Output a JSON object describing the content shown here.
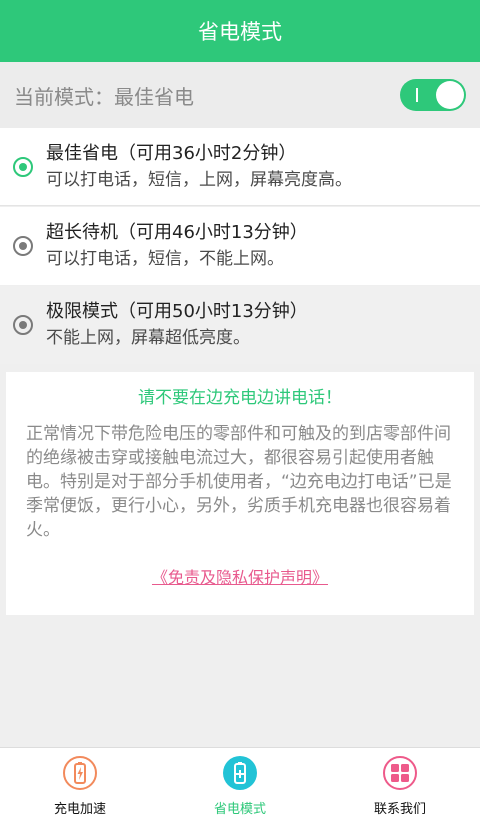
{
  "header": {
    "title": "省电模式"
  },
  "mode_bar": {
    "label": "当前模式：最佳省电",
    "toggle_on": true
  },
  "options": [
    {
      "title": "最佳省电（可用36小时2分钟）",
      "desc": "可以打电话，短信，上网，屏幕亮度高。",
      "selected": true
    },
    {
      "title": "超长待机（可用46小时13分钟）",
      "desc": "可以打电话，短信，不能上网。",
      "selected": false
    },
    {
      "title": "极限模式（可用50小时13分钟）",
      "desc": "不能上网，屏幕超低亮度。",
      "selected": false
    }
  ],
  "warning": {
    "title": "请不要在边充电边讲电话！",
    "text": "正常情况下带危险电压的零部件和可触及的到店零部件间的绝缘被击穿或接触电流过大，都很容易引起使用者触电。特别是对于部分手机使用者，“边充电边打电话”已是季常便饭，更行小心，另外，劣质手机充电器也很容易着火。",
    "disclaimer": "《免责及隐私保护声明》"
  },
  "tabs": [
    {
      "label": "充电加速",
      "icon": "battery-bolt-icon",
      "active": false
    },
    {
      "label": "省电模式",
      "icon": "battery-plus-icon",
      "active": true
    },
    {
      "label": "联系我们",
      "icon": "grid-icon",
      "active": false
    }
  ],
  "colors": {
    "accent": "#2ec87a",
    "link": "#e85a8e",
    "tab_charge": "#f28a5c",
    "tab_save": "#22c3d6",
    "tab_contact": "#ee5a8a"
  }
}
